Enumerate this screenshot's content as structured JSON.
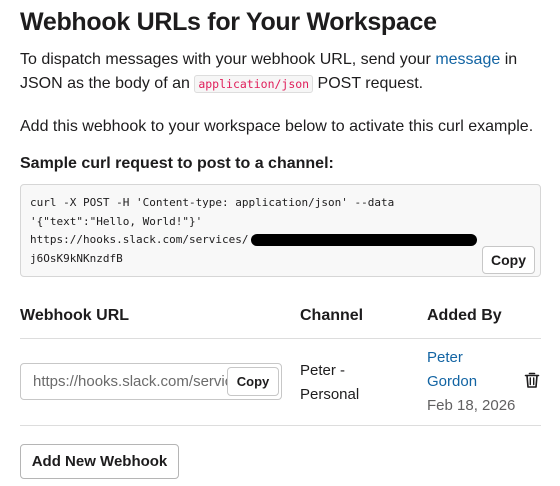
{
  "page": {
    "title": "Webhook URLs for Your Workspace",
    "intro_before_link": "To dispatch messages with your webhook URL, send your ",
    "intro_link": "message",
    "intro_middle": " in JSON as the body of an ",
    "intro_code": "application/json",
    "intro_after": " POST request.",
    "note": "Add this webhook to your workspace below to activate this curl example.",
    "sample_heading": "Sample curl request to post to a channel:"
  },
  "curl": {
    "line1": "curl -X POST -H 'Content-type: application/json' --data",
    "line2": "'{\"text\":\"Hello, World!\"}'",
    "line3": "https://hooks.slack.com/services/",
    "line4": "j6OsK9kNKnzdfB",
    "copy_label": "Copy"
  },
  "table": {
    "headers": {
      "url": "Webhook URL",
      "channel": "Channel",
      "added_by": "Added By"
    },
    "rows": [
      {
        "url": "https://hooks.slack.com/services/",
        "copy_label": "Copy",
        "channel_line1": "Peter -",
        "channel_line2": "Personal",
        "added_by_first": "Peter",
        "added_by_last": "Gordon",
        "date": "Feb 18, 2026",
        "delete_icon": "trash-icon"
      }
    ]
  },
  "actions": {
    "add_label": "Add New Webhook"
  }
}
